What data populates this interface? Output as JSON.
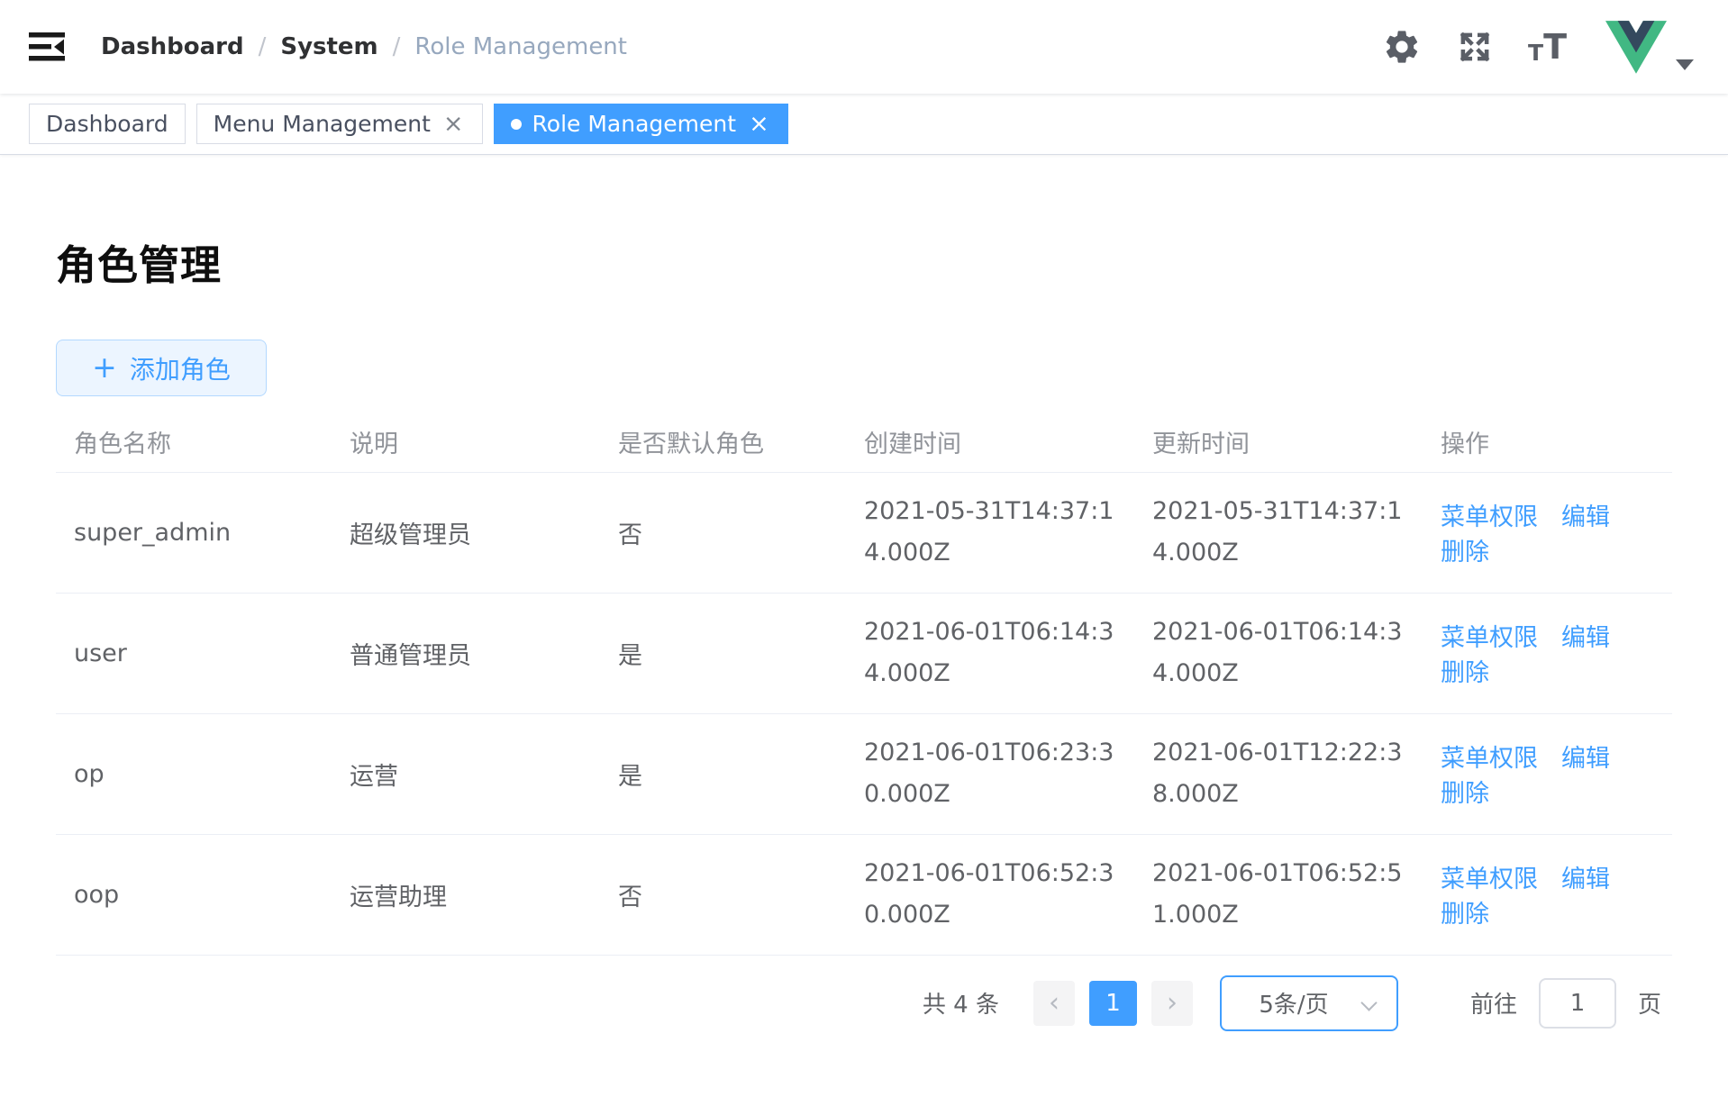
{
  "navbar": {
    "separator": "/",
    "breadcrumb": [
      {
        "label": "Dashboard",
        "style": "bold"
      },
      {
        "label": "System",
        "style": "bold"
      },
      {
        "label": "Role Management",
        "style": "current"
      }
    ],
    "icons": {
      "hamburger": "sidebar-toggle",
      "gear": "settings",
      "fullscreen": "fullscreen-toggle",
      "font_size": "tT",
      "avatar": "vue-logo",
      "caret": "dropdown-caret"
    },
    "colors": {
      "vue_green": "#41b883",
      "vue_navy": "#34495e",
      "icon_gray": "#5a5e66"
    }
  },
  "tags": [
    {
      "label": "Dashboard",
      "closable": false,
      "active": false
    },
    {
      "label": "Menu Management",
      "closable": true,
      "active": false
    },
    {
      "label": "Role Management",
      "closable": true,
      "active": true
    }
  ],
  "page": {
    "title": "角色管理",
    "add_button": "添加角色"
  },
  "table": {
    "columns": [
      "角色名称",
      "说明",
      "是否默认角色",
      "创建时间",
      "更新时间",
      "操作"
    ],
    "fields": [
      "name",
      "desc",
      "is_default",
      "created_at",
      "updated_at"
    ],
    "actions": [
      "菜单权限",
      "编辑",
      "删除"
    ],
    "rows": [
      {
        "name": "super_admin",
        "desc": "超级管理员",
        "is_default": "否",
        "created_at": "2021-05-31T14:37:14.000Z",
        "updated_at": "2021-05-31T14:37:14.000Z"
      },
      {
        "name": "user",
        "desc": "普通管理员",
        "is_default": "是",
        "created_at": "2021-06-01T06:14:34.000Z",
        "updated_at": "2021-06-01T06:14:34.000Z"
      },
      {
        "name": "op",
        "desc": "运营",
        "is_default": "是",
        "created_at": "2021-06-01T06:23:30.000Z",
        "updated_at": "2021-06-01T12:22:38.000Z"
      },
      {
        "name": "oop",
        "desc": "运营助理",
        "is_default": "否",
        "created_at": "2021-06-01T06:52:30.000Z",
        "updated_at": "2021-06-01T06:52:51.000Z"
      }
    ]
  },
  "pagination": {
    "total_text": "共 4 条",
    "current_page": "1",
    "page_size": "5条/页",
    "goto_label": "前往",
    "goto_value": "1",
    "page_label": "页"
  },
  "colors": {
    "primary": "#409eff",
    "link": "#409eff",
    "active_tab_bg": "#409eff"
  }
}
